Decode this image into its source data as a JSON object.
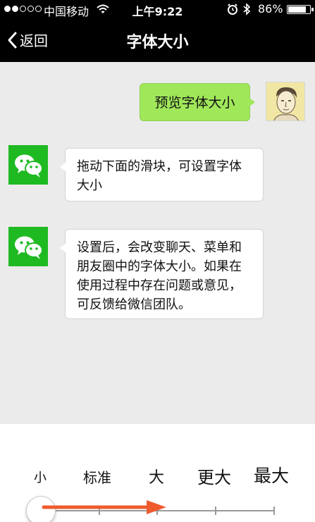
{
  "status_bar": {
    "carrier": "中国移动",
    "time": "上午9:22",
    "battery": "86%",
    "signal_filled": 2,
    "signal_total": 5,
    "battery_level": 0.86
  },
  "nav": {
    "back_label": "返回",
    "title": "字体大小"
  },
  "chat": {
    "user_message": "预览字体大小",
    "messages": [
      "拖动下面的滑块，可设置字体大小",
      "设置后，会改变聊天、菜单和朋友圈中的字体大小。如果在使用过程中存在问题或意见，可反馈给微信团队。"
    ]
  },
  "font_size": {
    "levels": [
      "小",
      "标准",
      "大",
      "更大",
      "最大"
    ],
    "selected_index": 0
  },
  "colors": {
    "bar_background": "#000000",
    "chat_background": "#ebebeb",
    "user_bubble": "#a0e75a",
    "wechat_green": "#1fb922",
    "arrow": "#ee5b2f"
  }
}
